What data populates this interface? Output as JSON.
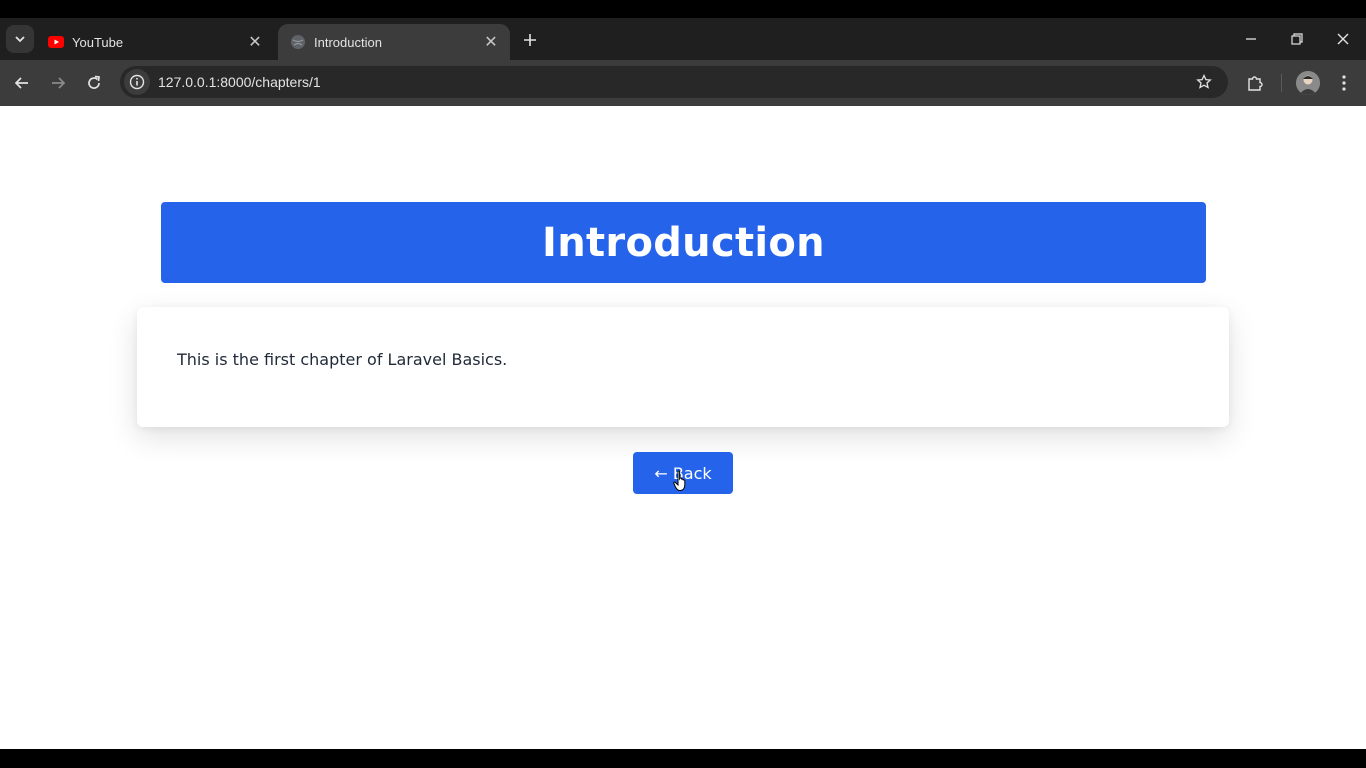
{
  "browser": {
    "tabs": [
      {
        "title": "YouTube",
        "favicon": "youtube-icon",
        "active": false
      },
      {
        "title": "Introduction",
        "favicon": "globe-icon",
        "active": true
      }
    ],
    "url": "127.0.0.1:8000/chapters/1",
    "colors": {
      "frame": "#1f1f1f",
      "toolbar": "#3c3c3c",
      "omnibox": "#282828",
      "youtube_red": "#ff0000"
    }
  },
  "page": {
    "heading": "Introduction",
    "body_text": "This is the first chapter of Laravel Basics.",
    "back_button_label": "← Back",
    "colors": {
      "accent": "#2563eb",
      "text": "#1f2937",
      "background": "#ffffff"
    }
  }
}
